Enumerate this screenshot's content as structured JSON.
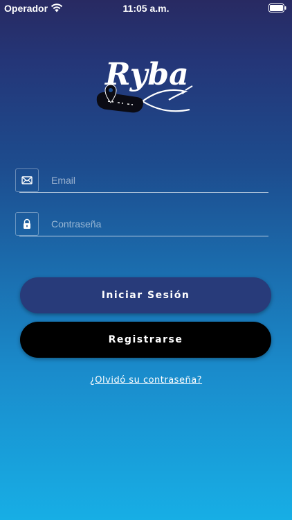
{
  "status_bar": {
    "carrier": "Operador",
    "time": "11:05 a.m."
  },
  "logo": {
    "text": "Ryba"
  },
  "form": {
    "email_placeholder": "Email",
    "password_placeholder": "Contraseña"
  },
  "buttons": {
    "login_label": "Iniciar Sesión",
    "register_label": "Registrarse"
  },
  "links": {
    "forgot_password": "¿Olvidó su contraseña?"
  },
  "colors": {
    "login_button": "#283b7a",
    "register_button": "#000000",
    "gradient_top": "#282a62",
    "gradient_bottom": "#17aee5"
  }
}
